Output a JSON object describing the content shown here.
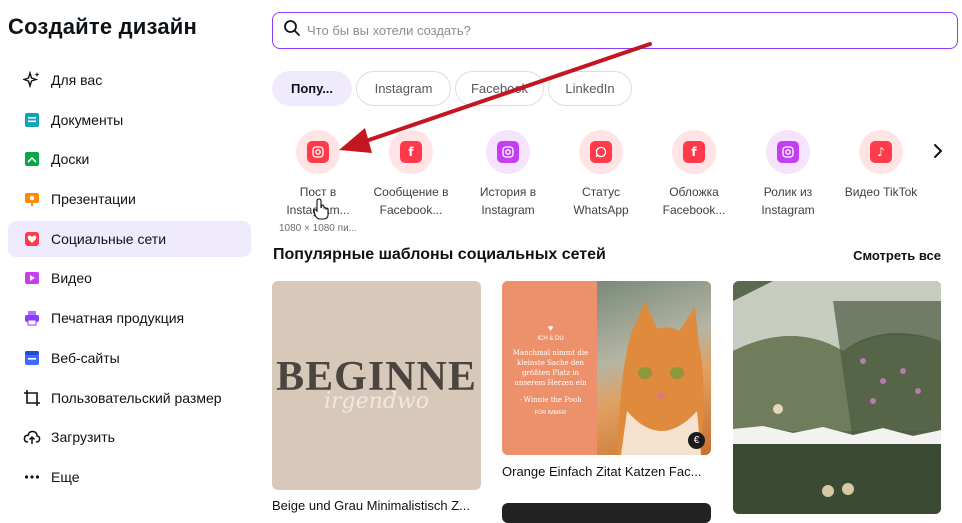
{
  "page_title": "Создайте дизайн",
  "nav": {
    "items": [
      {
        "label": "Для вас",
        "icon": "sparkle-icon",
        "color": "#0d1216"
      },
      {
        "label": "Документы",
        "icon": "document-icon",
        "color": "#13a3b5"
      },
      {
        "label": "Доски",
        "icon": "whiteboard-icon",
        "color": "#0ba84a"
      },
      {
        "label": "Презентации",
        "icon": "presentation-icon",
        "color": "#ff8b00"
      },
      {
        "label": "Социальные сети",
        "icon": "heart-icon",
        "color": "#ff3b4b"
      },
      {
        "label": "Видео",
        "icon": "video-icon",
        "color": "#c53ef0"
      },
      {
        "label": "Печатная продукция",
        "icon": "printer-icon",
        "color": "#8b3dff"
      },
      {
        "label": "Веб-сайты",
        "icon": "website-icon",
        "color": "#3d6bff"
      },
      {
        "label": "Пользовательский размер",
        "icon": "crop-icon",
        "color": "#0d1216"
      },
      {
        "label": "Загрузить",
        "icon": "upload-cloud-icon",
        "color": "#0d1216"
      },
      {
        "label": "Еще",
        "icon": "more-icon",
        "color": "#0d1216"
      }
    ],
    "active_index": 4
  },
  "search": {
    "placeholder": "Что бы вы хотели создать?"
  },
  "chips": [
    "Попу...",
    "Instagram",
    "Facebook",
    "LinkedIn"
  ],
  "types": [
    {
      "line1": "Пост в",
      "line2": "Instagram...",
      "sub": "1080 × 1080 пи...",
      "icon": "instagram-icon",
      "bg": "#ffe3e5",
      "ic": "#ff3b4b"
    },
    {
      "line1": "Сообщение в",
      "line2": "Facebook...",
      "icon": "facebook-icon",
      "bg": "#ffe3e5",
      "ic": "#ff3b4b"
    },
    {
      "line1": "История в",
      "line2": "Instagram",
      "icon": "instagram-story-icon",
      "bg": "#f6e3fd",
      "ic": "#c53ef0"
    },
    {
      "line1": "Статус",
      "line2": "WhatsApp",
      "icon": "whatsapp-icon",
      "bg": "#ffe3e5",
      "ic": "#ff3b4b"
    },
    {
      "line1": "Обложка",
      "line2": "Facebook...",
      "icon": "facebook-cover-icon",
      "bg": "#ffe3e5",
      "ic": "#ff3b4b"
    },
    {
      "line1": "Ролик из",
      "line2": "Instagram",
      "icon": "instagram-reel-icon",
      "bg": "#f6e3fd",
      "ic": "#c53ef0"
    },
    {
      "line1": "Видео TikTok",
      "line2": "",
      "icon": "tiktok-icon",
      "bg": "#ffe3e5",
      "ic": "#ff3b4b"
    }
  ],
  "section": {
    "title": "Популярные шаблоны социальных сетей",
    "see_all": "Смотреть все"
  },
  "templates": [
    {
      "label": "Beige und Grau Minimalistisch Z...",
      "big_text": "BEGINNE",
      "script_text": "irgendwo"
    },
    {
      "label": "Orange Einfach Zitat Katzen Fac...",
      "quote": "Manchmal nimmt die kleinste Sache den größten Platz in unserem Herzen ein",
      "author": "- Winnie the Pooh",
      "tag": "ICH & DU",
      "brand": "FÜR IMMER",
      "badge": "€"
    },
    {
      "label": ""
    }
  ]
}
